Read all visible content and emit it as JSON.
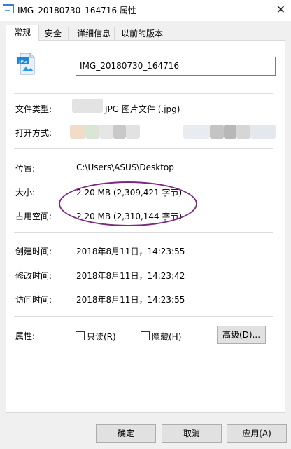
{
  "window": {
    "title": "IMG_20180730_164716 属性",
    "close_glyph": "✕"
  },
  "tabs": [
    "常规",
    "安全",
    "详细信息",
    "以前的版本"
  ],
  "general": {
    "filename": "IMG_20180730_164716",
    "icon_label": "JPG",
    "file_type_label": "文件类型:",
    "file_type_value": "JPG 图片文件 (.jpg)",
    "open_with_label": "打开方式:",
    "location_label": "位置:",
    "location_value": "C:\\Users\\ASUS\\Desktop",
    "size_label": "大小:",
    "size_value": "2.20 MB (2,309,421 字节)",
    "disk_size_label": "占用空间:",
    "disk_size_value": "2.20 MB (2,310,144 字节)",
    "created_label": "创建时间:",
    "created_value": "2018年8月11日，14:23:55",
    "modified_label": "修改时间:",
    "modified_value": "2018年8月11日，14:23:42",
    "accessed_label": "访问时间:",
    "accessed_value": "2018年8月11日，14:23:55",
    "attributes_label": "属性:",
    "readonly_label": "只读(R)",
    "hidden_label": "隐藏(H)",
    "advanced_button": "高级(D)..."
  },
  "footer": {
    "ok": "确定",
    "cancel": "取消",
    "apply": "应用(A)"
  },
  "colors": {
    "highlight_ellipse": "#7b2b7e"
  }
}
